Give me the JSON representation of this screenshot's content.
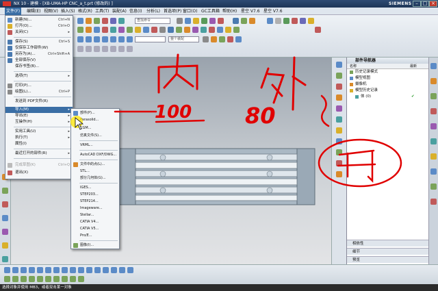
{
  "window": {
    "title": "NX 10 - 建模 - [XB-UMA-HP CNC_a_t.prt  (修改的) ]",
    "brand": "SIEMENS",
    "controls": [
      "minimize",
      "maximize",
      "close"
    ]
  },
  "menubar": {
    "items": [
      "文件(F)",
      "编辑(E)",
      "视图(V)",
      "插入(S)",
      "格式(R)",
      "工具(T)",
      "装配(A)",
      "信息(I)",
      "分析(L)",
      "首选项(P)",
      "窗口(O)",
      "GC工具箱",
      "帮助(H)",
      "星空 V7.6",
      "星空 V7.6"
    ],
    "active_index": 0
  },
  "toolbar": {
    "search_placeholder": "查找命令",
    "combo_left": "",
    "combo_filter": "整个装配"
  },
  "file_menu": {
    "items": [
      {
        "label": "新建(N)...",
        "shortcut": "Ctrl+N",
        "icon": "new-icon"
      },
      {
        "label": "打开(O)...",
        "shortcut": "Ctrl+O",
        "icon": "open-icon"
      },
      {
        "label": "关闭(C)",
        "shortcut": "▸",
        "icon": "close-file-icon"
      },
      {
        "label": "保存(S)",
        "shortcut": "Ctrl+S",
        "icon": "save-icon"
      },
      {
        "label": "仅保存工作部件(W)",
        "shortcut": "",
        "icon": "save-work-icon"
      },
      {
        "label": "另存为(A)...",
        "shortcut": "Ctrl+Shift+A",
        "icon": "save-as-icon"
      },
      {
        "label": "全部保存(V)",
        "shortcut": "",
        "icon": "save-all-icon"
      },
      {
        "label": "保存书签(B)...",
        "shortcut": "",
        "icon": "bookmark-icon"
      },
      {
        "label": "选项(T)",
        "shortcut": "▸",
        "icon": ""
      },
      {
        "label": "打印(P)...",
        "shortcut": "",
        "icon": "print-icon"
      },
      {
        "label": "绘图(L)...",
        "shortcut": "Ctrl+P",
        "icon": "plot-icon"
      },
      {
        "label": "发送到 PDF文件(R)",
        "shortcut": "",
        "icon": ""
      },
      {
        "label": "导入(M)",
        "shortcut": "▸",
        "icon": ""
      },
      {
        "label": "导出(E)",
        "shortcut": "▸",
        "icon": ""
      },
      {
        "label": "互操作(H)",
        "shortcut": "▸",
        "icon": ""
      },
      {
        "label": "实用工具(U)",
        "shortcut": "▸",
        "icon": ""
      },
      {
        "label": "执行(T)",
        "shortcut": "▸",
        "icon": ""
      },
      {
        "label": "属性(I)",
        "shortcut": "",
        "icon": "properties-icon"
      },
      {
        "label": "最近打开的部件(R)",
        "shortcut": "▸",
        "icon": ""
      },
      {
        "label": "完成草图(K)",
        "shortcut": "Ctrl+Q",
        "icon": "finish-sketch-icon"
      },
      {
        "label": "退出(X)",
        "shortcut": "",
        "icon": "exit-icon"
      }
    ],
    "highlighted_index": 12,
    "disabled_index": 19
  },
  "import_menu": {
    "items": [
      "部件(P)...",
      "Parasolid...",
      "CGM...",
      "仿真文件(S)...",
      "VRML...",
      "AutoCAD DXF/DWG...",
      "文件中的点(L)...",
      "STL...",
      "部分几何体(G)...",
      "IGES...",
      "STEP203...",
      "STEP214...",
      "Imageware...",
      "Stellar...",
      "CATIA V4...",
      "CATIA V5...",
      "Pro/E...",
      "图像(I)..."
    ]
  },
  "navigator": {
    "title": "部件导航器",
    "col_name": "名称",
    "col_latest": "最新",
    "rows": [
      "历史记录模式",
      "模型视图",
      "摄像机",
      "模型历史记录",
      "体 (0)"
    ],
    "latest_mark": "✔",
    "sections": [
      "相依性",
      "细节",
      "预览"
    ]
  },
  "status": {
    "text": "选择对象并使用 MB3，或者双击某一对象"
  },
  "annotations": {
    "text_1": "内",
    "text_2": "外",
    "number_1": "100",
    "number_2": "80"
  },
  "colors": {
    "menu_highlight": "#3a6ea5",
    "annotation": "#e00000",
    "titlebar": "#1d3557",
    "part": "#aab8c4"
  }
}
